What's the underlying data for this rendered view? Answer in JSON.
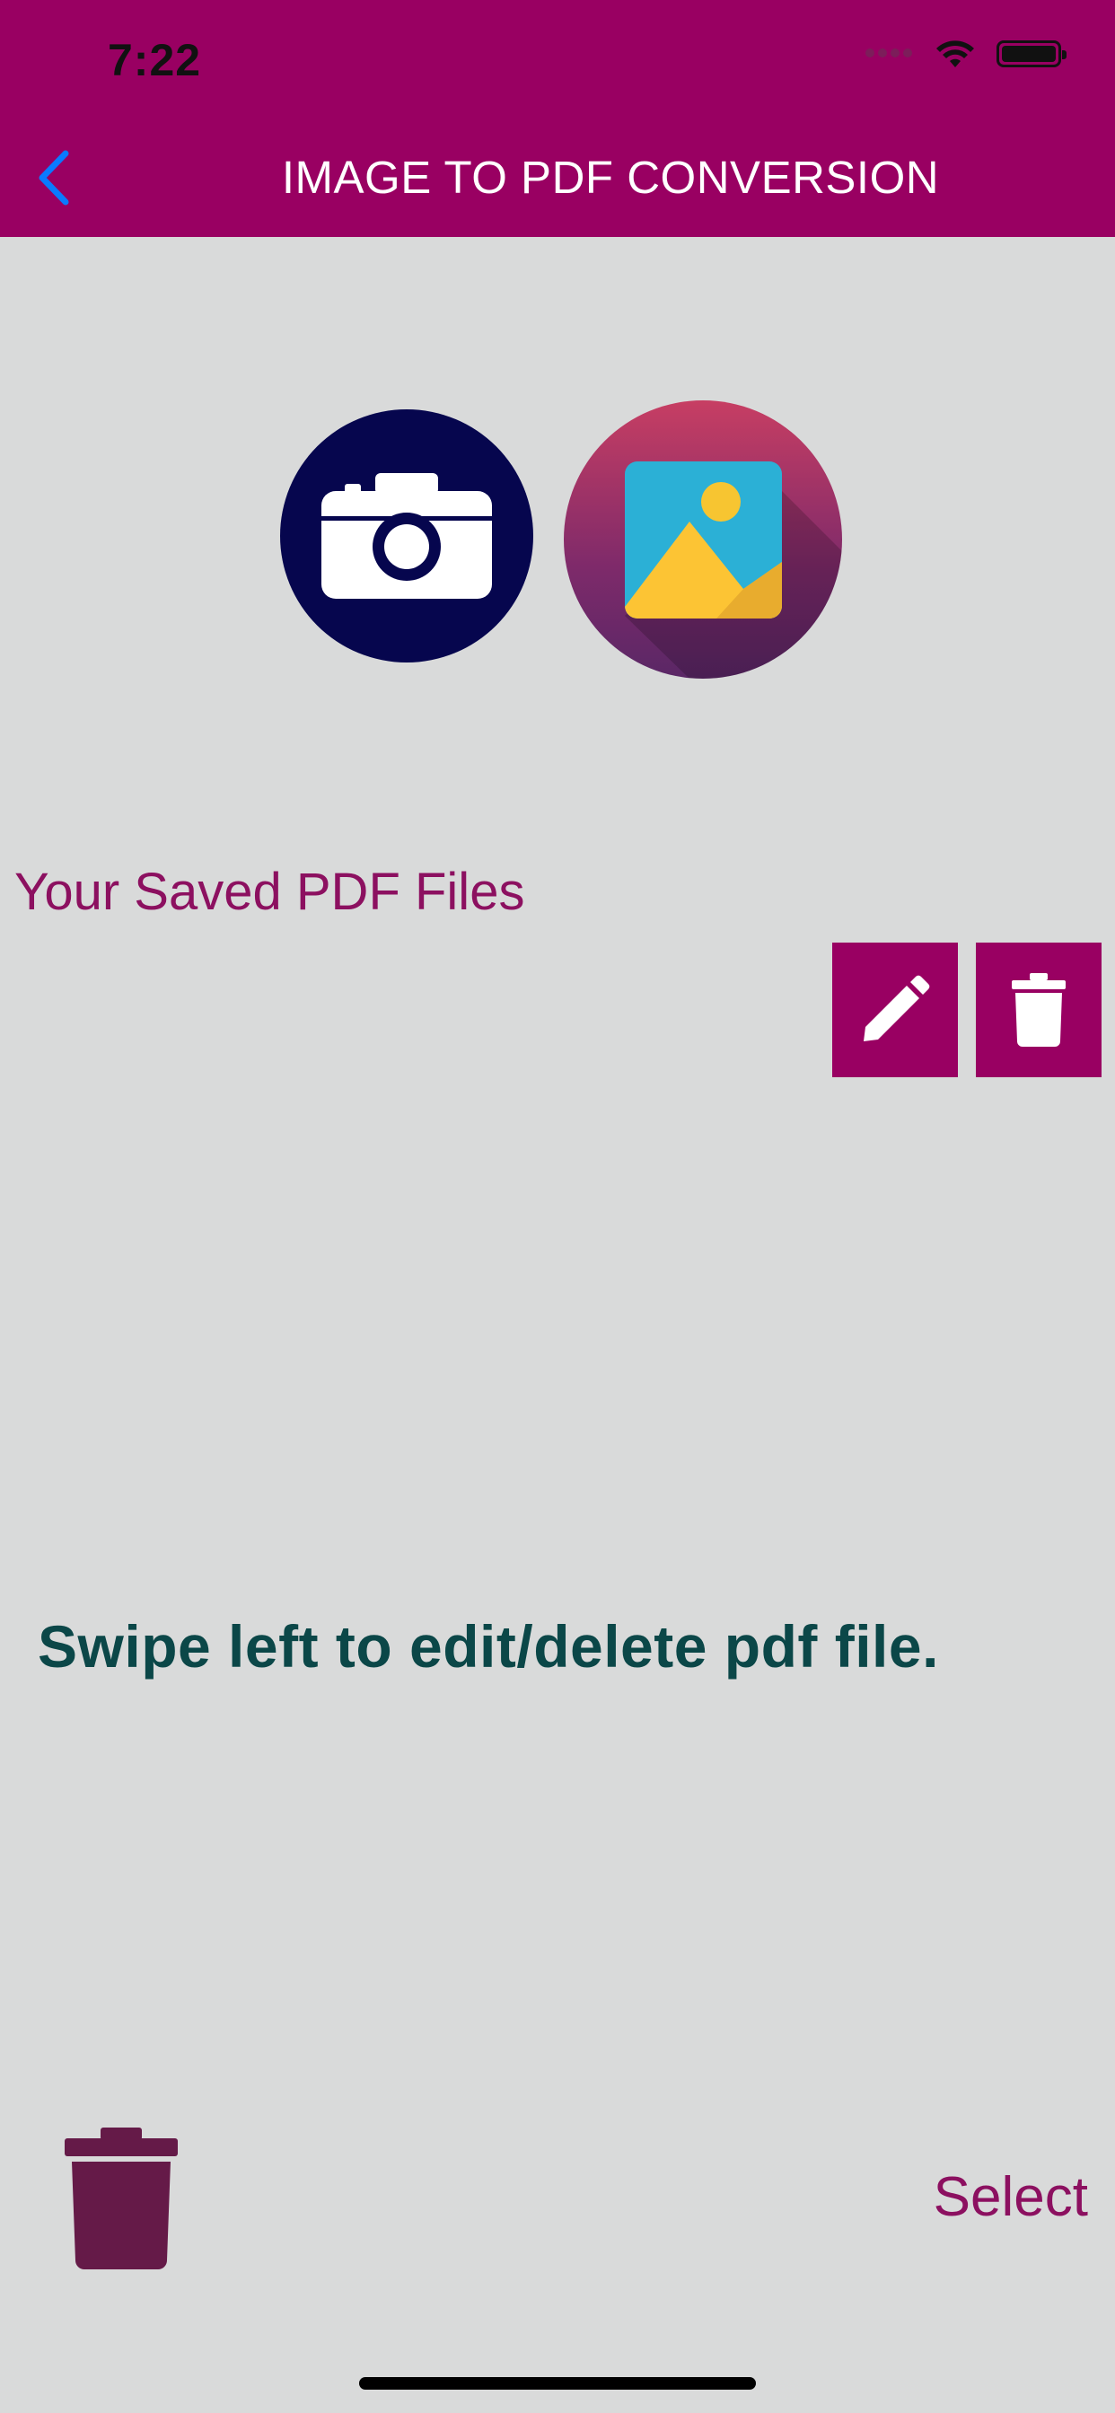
{
  "status_bar": {
    "time": "7:22"
  },
  "header": {
    "title": "IMAGE TO PDF CONVERSION",
    "back_icon": "chevron-left-icon"
  },
  "sources": {
    "camera_icon": "camera-icon",
    "gallery_icon": "image-icon"
  },
  "saved_section": {
    "title": "Your Saved PDF Files",
    "edit_icon": "pencil-icon",
    "delete_icon": "trash-icon"
  },
  "hint": {
    "text": "Swipe left to edit/delete pdf file."
  },
  "bottom_bar": {
    "delete_all_icon": "trash-icon",
    "select_label": "Select"
  },
  "colors": {
    "header": "#990062",
    "accent": "#8c1060",
    "background": "#d9dada",
    "hint_text": "#0b4748",
    "back_icon": "#0a7aff"
  }
}
